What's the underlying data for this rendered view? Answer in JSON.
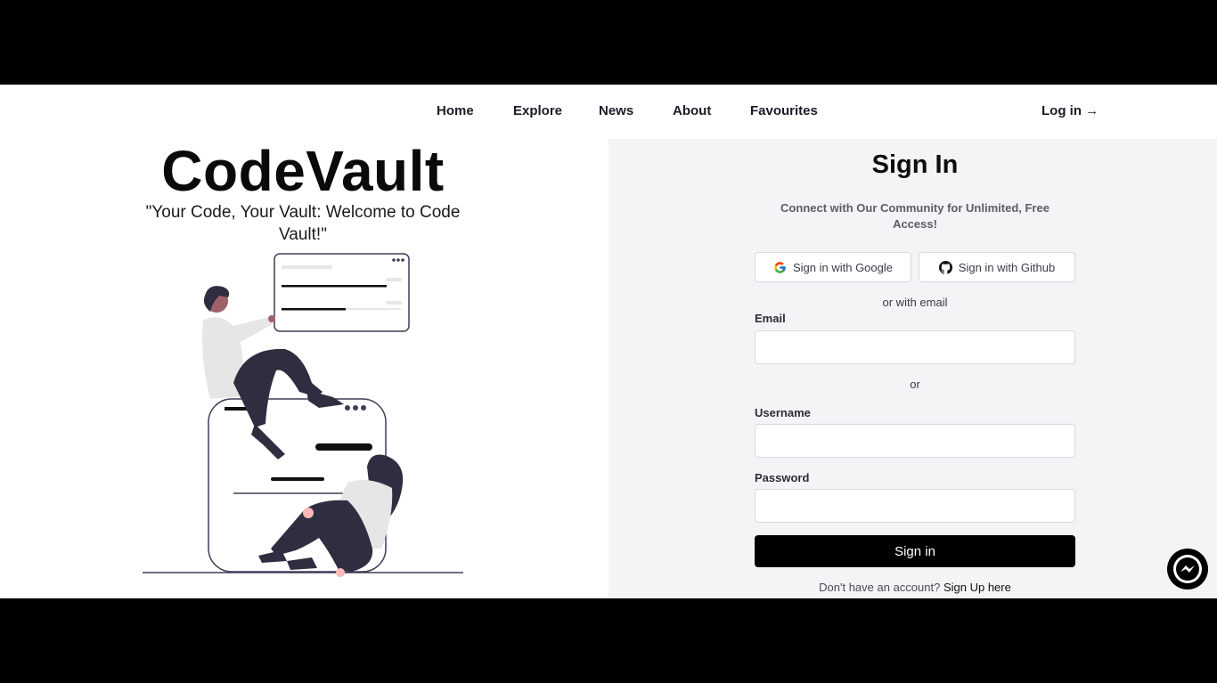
{
  "nav": {
    "items": [
      {
        "label": "Home"
      },
      {
        "label": "Explore"
      },
      {
        "label": "News"
      },
      {
        "label": "About"
      },
      {
        "label": "Favourites"
      }
    ],
    "login_label": "Log in →"
  },
  "hero": {
    "brand": "CodeVault",
    "tagline": "\"Your Code, Your Vault: Welcome to Code Vault!\""
  },
  "signin": {
    "title": "Sign In",
    "subtitle": "Connect with Our Community for Unlimited, Free Access!",
    "google_label": "Sign in with Google",
    "github_label": "Sign in with Github",
    "or_email": "or with email",
    "email_label": "Email",
    "email_value": "",
    "or_label": "or",
    "username_label": "Username",
    "username_value": "",
    "password_label": "Password",
    "password_value": "",
    "submit_label": "Sign in",
    "no_account": "Don't have an account?",
    "signup_link": "Sign Up here"
  },
  "icons": {
    "google": "google-icon",
    "github": "github-icon",
    "messenger": "messenger-icon"
  },
  "colors": {
    "accent": "#000000",
    "panel": "#f3f4f6"
  }
}
